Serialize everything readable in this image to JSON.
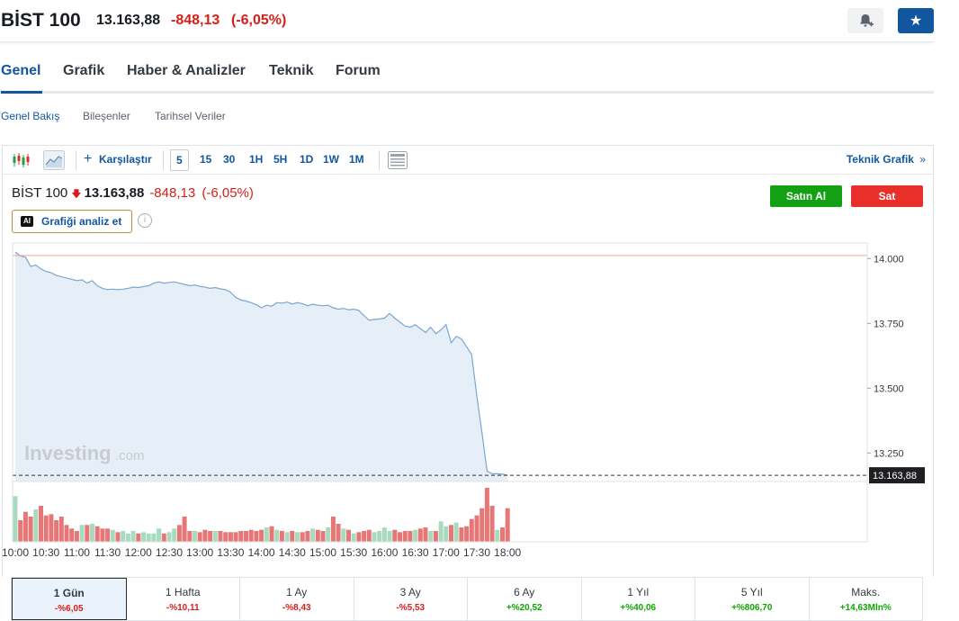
{
  "header": {
    "name": "BİST 100",
    "price": "13.163,88",
    "change": "-848,13",
    "change_pct": "(-6,05%)"
  },
  "tabs": [
    {
      "label": "Genel",
      "active": true
    },
    {
      "label": "Grafik"
    },
    {
      "label": "Haber & Analizler"
    },
    {
      "label": "Teknik"
    },
    {
      "label": "Forum"
    }
  ],
  "subtabs": [
    {
      "label": "Genel Bakış",
      "active": true
    },
    {
      "label": "Bileşenler"
    },
    {
      "label": "Tarihsel Veriler"
    }
  ],
  "toolbar": {
    "compare": "Karşılaştır",
    "intervals": [
      "5",
      "15",
      "30",
      "1H",
      "5H",
      "1D",
      "1W",
      "1M"
    ],
    "active_interval": "5",
    "teknik": "Teknik Grafik",
    "teknik_arrow": "»"
  },
  "chart_header": {
    "name": "BİST 100",
    "price": "13.163,88",
    "change": "-848,13",
    "change_pct": "(-6,05%)",
    "buy": "Satın Al",
    "sell": "Sat",
    "ai_badge": "AI",
    "ai_label": "Grafiği analiz et",
    "info": "i"
  },
  "watermark": "Investing",
  "watermark_suffix": ".com",
  "chart_data": {
    "type": "area",
    "x": [
      "10:00",
      "10:05",
      "10:10",
      "10:15",
      "10:20",
      "10:25",
      "10:30",
      "10:35",
      "10:40",
      "10:45",
      "10:50",
      "10:55",
      "11:00",
      "11:05",
      "11:10",
      "11:15",
      "11:20",
      "11:25",
      "11:30",
      "11:35",
      "11:40",
      "11:45",
      "11:50",
      "11:55",
      "12:00",
      "12:05",
      "12:10",
      "12:15",
      "12:20",
      "12:25",
      "12:30",
      "12:35",
      "12:40",
      "12:45",
      "12:50",
      "12:55",
      "13:00",
      "13:05",
      "13:10",
      "13:15",
      "13:20",
      "13:25",
      "13:30",
      "13:35",
      "13:40",
      "13:45",
      "13:50",
      "13:55",
      "14:00",
      "14:05",
      "14:10",
      "14:15",
      "14:20",
      "14:25",
      "14:30",
      "14:35",
      "14:40",
      "14:45",
      "14:50",
      "14:55",
      "15:00",
      "15:05",
      "15:10",
      "15:15",
      "15:20",
      "15:25",
      "15:30",
      "15:35",
      "15:40",
      "15:45",
      "15:50",
      "15:55",
      "16:00",
      "16:05",
      "16:10",
      "16:15",
      "16:20",
      "16:25",
      "16:30",
      "16:35",
      "16:40",
      "16:45",
      "16:50",
      "16:55",
      "17:00",
      "17:05",
      "17:10",
      "17:15",
      "17:20",
      "17:25",
      "17:30",
      "17:35",
      "17:40",
      "17:45",
      "17:50",
      "17:55",
      "18:00"
    ],
    "values": [
      14025,
      14010,
      14005,
      13970,
      13975,
      13960,
      13950,
      13945,
      13935,
      13930,
      13925,
      13920,
      13915,
      13918,
      13905,
      13915,
      13895,
      13885,
      13880,
      13882,
      13880,
      13882,
      13885,
      13890,
      13888,
      13892,
      13895,
      13905,
      13910,
      13905,
      13908,
      13910,
      13905,
      13900,
      13895,
      13898,
      13893,
      13890,
      13885,
      13888,
      13883,
      13880,
      13870,
      13850,
      13840,
      13836,
      13830,
      13822,
      13810,
      13820,
      13816,
      13830,
      13828,
      13832,
      13825,
      13830,
      13826,
      13818,
      13824,
      13820,
      13818,
      13820,
      13810,
      13805,
      13808,
      13802,
      13805,
      13800,
      13780,
      13762,
      13765,
      13767,
      13770,
      13788,
      13770,
      13755,
      13740,
      13735,
      13745,
      13730,
      13715,
      13735,
      13710,
      13725,
      13745,
      13675,
      13700,
      13690,
      13660,
      13630,
      13470,
      13330,
      13180,
      13170,
      13170,
      13168,
      13163.88
    ],
    "volume": [
      38,
      18,
      25,
      21,
      27,
      30,
      22,
      23,
      18,
      21,
      14,
      11,
      9,
      14,
      14,
      15,
      13,
      11,
      11,
      10,
      8,
      9,
      7,
      9,
      7,
      8,
      7,
      7,
      11,
      7,
      8,
      11,
      14,
      21,
      9,
      9,
      8,
      10,
      9,
      9,
      9,
      8,
      8,
      8,
      9,
      9,
      10,
      9,
      10,
      12,
      13,
      10,
      9,
      8,
      9,
      8,
      8,
      9,
      11,
      10,
      9,
      12,
      21,
      15,
      11,
      10,
      7,
      8,
      9,
      10,
      8,
      9,
      12,
      9,
      10,
      8,
      9,
      9,
      10,
      11,
      12,
      9,
      9,
      17,
      13,
      14,
      16,
      12,
      13,
      19,
      22,
      28,
      45,
      30,
      10,
      12,
      28
    ],
    "x_ticks": [
      "10:00",
      "10:30",
      "11:00",
      "11:30",
      "12:00",
      "12:30",
      "13:00",
      "13:30",
      "14:00",
      "14:30",
      "15:00",
      "15:30",
      "16:00",
      "16:30",
      "17:00",
      "17:30",
      "18:00"
    ],
    "y_ticks": [
      "14.000",
      "13.750",
      "13.500",
      "13.250"
    ],
    "y_tick_values": [
      14000,
      13750,
      13500,
      13250
    ],
    "ylim": [
      13140,
      14060
    ],
    "last_label": "13.163,88",
    "last_value": 13163.88,
    "prev_close": 14012,
    "grid": false,
    "colors": {
      "line": "#7ba7cf",
      "fill": "#e6eef7",
      "prev_close": "#f5a3a0",
      "vol_up": "#a8dbbd",
      "vol_down": "#e77777"
    }
  },
  "periods": [
    {
      "label": "1 Gün",
      "value": "-%6,05",
      "sign": "neg",
      "active": true
    },
    {
      "label": "1 Hafta",
      "value": "-%10,11",
      "sign": "neg"
    },
    {
      "label": "1 Ay",
      "value": "-%8,43",
      "sign": "neg"
    },
    {
      "label": "3 Ay",
      "value": "-%5,53",
      "sign": "neg"
    },
    {
      "label": "6 Ay",
      "value": "+%20,52",
      "sign": "pos"
    },
    {
      "label": "1 Yıl",
      "value": "+%40,06",
      "sign": "pos"
    },
    {
      "label": "5 Yıl",
      "value": "+%806,70",
      "sign": "pos"
    },
    {
      "label": "Maks.",
      "value": "+14,63Mln%",
      "sign": "pos"
    }
  ]
}
